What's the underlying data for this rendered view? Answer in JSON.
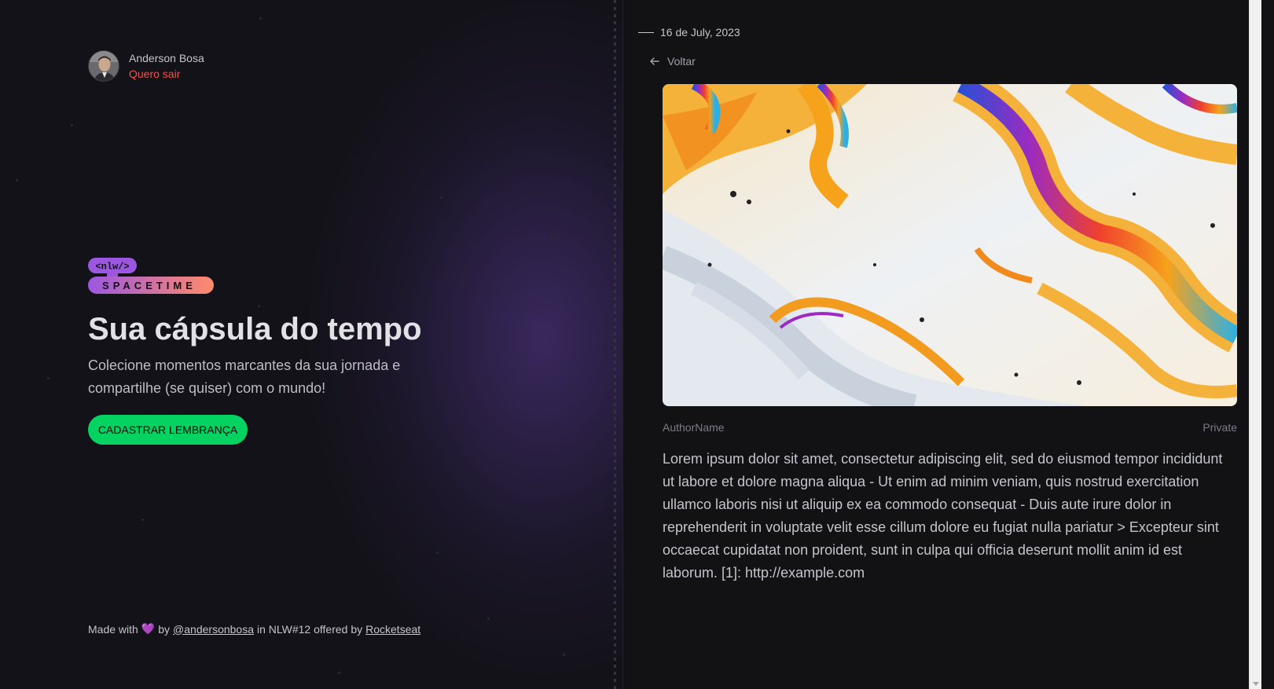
{
  "user": {
    "name": "Anderson Bosa",
    "logout_label": "Quero sair"
  },
  "logo": {
    "tag": "<nlw/>",
    "wordmark": "SPACETIME"
  },
  "hero": {
    "title": "Sua cápsula do tempo",
    "description": "Colecione momentos marcantes da sua jornada e compartilhe (se quiser) com o mundo!",
    "cta_label": "CADASTRAR LEMBRANÇA"
  },
  "footer": {
    "made_with": "Made with",
    "by": "by",
    "author_link": "@andersonbosa",
    "middle": "in NLW#12 offered by",
    "sponsor_link": "Rocketseat"
  },
  "memory": {
    "date": "16 de July, 2023",
    "back_label": "Voltar",
    "author": "AuthorName",
    "visibility": "Private",
    "content": "Lorem ipsum dolor sit amet, consectetur adipiscing elit, sed do eiusmod tempor incididunt ut labore et dolore magna aliqua - Ut enim ad minim veniam, quis nostrud exercitation ullamco laboris nisi ut aliquip ex ea commodo consequat - Duis aute irure dolor in reprehenderit in voluptate velit esse cillum dolore eu fugiat nulla pariatur > Excepteur sint occaecat cupidatat non proident, sunt in culpa qui officia deserunt mollit anim id est laborum. [1]: http://example.com"
  },
  "colors": {
    "accent_green": "#04d361",
    "logout_red": "#ef5050",
    "logo_purple": "#9b57e0",
    "logo_orange": "#ff8b6a"
  },
  "icons": {
    "back": "arrow-left-icon",
    "heart": "purple-heart-icon"
  }
}
